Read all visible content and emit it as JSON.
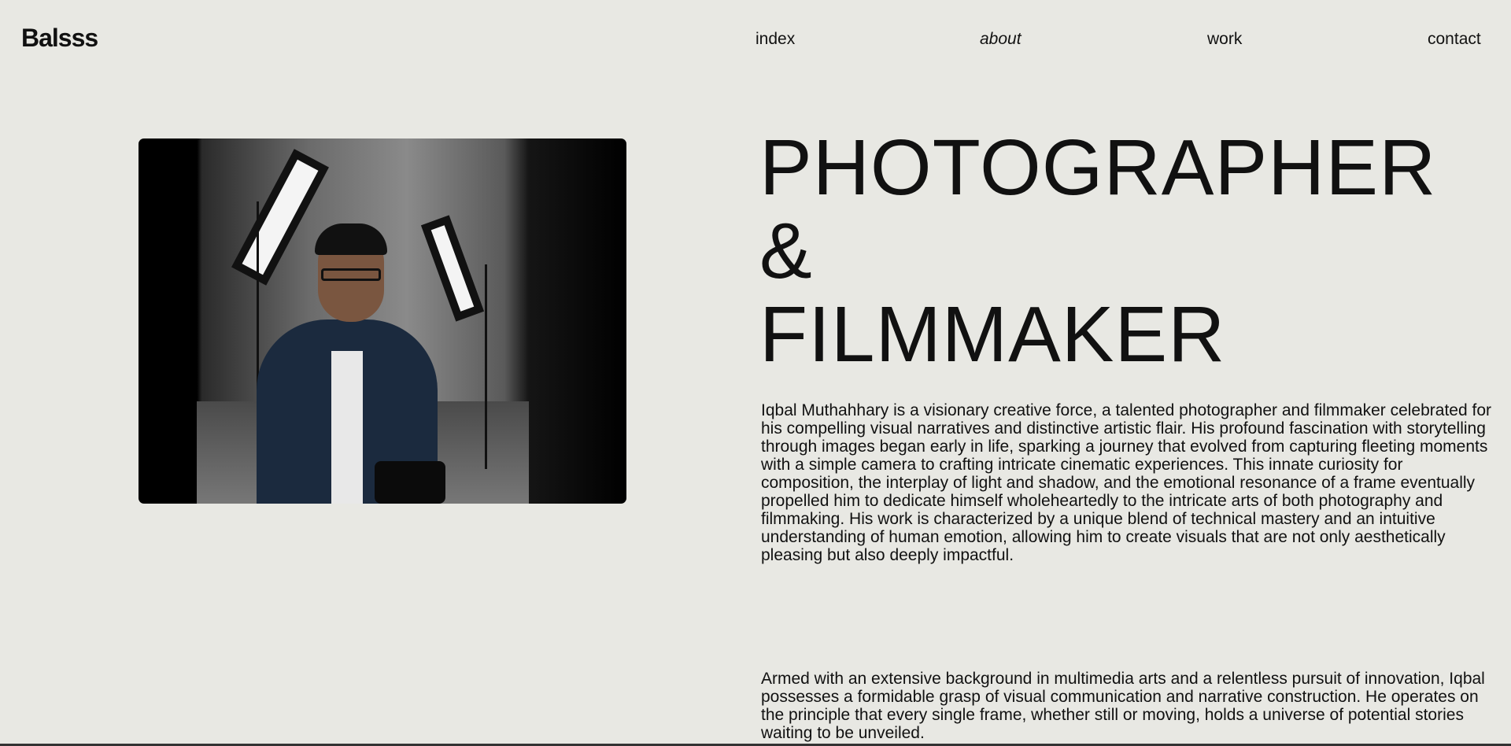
{
  "header": {
    "logo": "Balsss",
    "nav": [
      {
        "label": "index"
      },
      {
        "label": "about"
      },
      {
        "label": "work"
      },
      {
        "label": "contact"
      }
    ]
  },
  "hero": {
    "title_line1": "PHOTOGRAPHER &",
    "title_line2": "FILMMAKER"
  },
  "bio": {
    "paragraph1": "Iqbal Muthahhary is a visionary creative force, a talented photographer and filmmaker celebrated for his compelling visual narratives and distinctive artistic flair. His profound fascination with storytelling through images began early in life, sparking a journey that evolved from capturing fleeting moments with a simple camera to crafting intricate cinematic experiences. This innate curiosity for composition, the interplay of light and shadow, and the emotional resonance of a frame eventually propelled him to dedicate himself wholeheartedly to the intricate arts of both photography and filmmaking. His work is characterized by a unique blend of technical mastery and an intuitive understanding of human emotion, allowing him to create visuals that are not only aesthetically pleasing but also deeply impactful.",
    "paragraph2": "Armed with an extensive background in multimedia arts and a relentless pursuit of innovation, Iqbal possesses a formidable grasp of visual communication and narrative construction. He operates on the principle that every single frame, whether still or moving, holds a universe of potential stories waiting to be unveiled."
  }
}
